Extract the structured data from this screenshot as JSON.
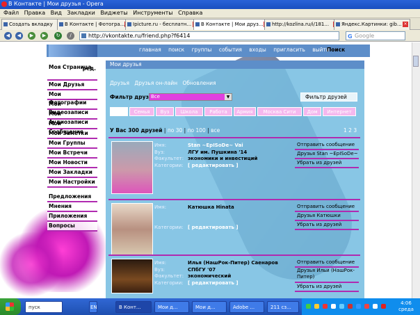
{
  "window": {
    "title": "В Контакте | Мои друзья - Opera"
  },
  "menubar": [
    "Файл",
    "Правка",
    "Вид",
    "Закладки",
    "Виджеты",
    "Инструменты",
    "Справка"
  ],
  "tabs": [
    {
      "label": "Создать вкладку"
    },
    {
      "label": "В Контакте | Фотогра..."
    },
    {
      "label": "Ipicture.ru - бесплатн..."
    },
    {
      "label": "В Контакте | Мои друз..."
    },
    {
      "label": "http://kozlina.ru/i/181..."
    },
    {
      "label": "Яндекс.Картинки: gib..."
    }
  ],
  "address": {
    "url": "http://vkontakte.ru/friend.php?f6414",
    "search_placeholder": "Google"
  },
  "vk": {
    "topnav": [
      "главная",
      "поиск",
      "группы",
      "события",
      "входы",
      "пригласить",
      "выйти"
    ],
    "search": "Поиск",
    "left_menu": [
      {
        "label": "Моя Страница",
        "extra": "ред."
      },
      {
        "label": "Мои Друзья"
      },
      {
        "label": "Мои Фотографии"
      },
      {
        "label": "Мои Видеозаписи"
      },
      {
        "label": "Мои Аудиозаписи"
      },
      {
        "label": "Мои Сообщения"
      },
      {
        "label": "Мои Заметки"
      },
      {
        "label": "Мои Группы"
      },
      {
        "label": "Мои Встречи"
      },
      {
        "label": "Мои Новости"
      },
      {
        "label": "Мои Закладки"
      },
      {
        "label": "Мои Настройки"
      }
    ],
    "left_menu_2": [
      "Предложения",
      "Мнения",
      "Приложения",
      "Вопросы"
    ],
    "main_title": "Мои друзья",
    "subtabs": [
      "Друзья",
      "Друзья он-лайн",
      "Обновления"
    ],
    "filter": {
      "label": "Фильтр друзей",
      "value": "Все",
      "button": "Фильтр друзей"
    },
    "categories": [
      "",
      "Семья",
      "Вуз",
      "Школа",
      "Работа",
      "Армия",
      "Москва Сити",
      "Дом",
      "Интернет"
    ],
    "count": {
      "text": "У Вас 300 друзей",
      "sep": "|",
      "by30": "по 30",
      "by100": "по 100",
      "all": "все"
    },
    "pages": [
      "1",
      "2",
      "3"
    ],
    "field_labels": {
      "name": "Имя:",
      "uni": "Вуз:",
      "faculty": "Факультет:",
      "category": "Категории:"
    },
    "friends": [
      {
        "name": "Stan ~EpISoDe~ Vai",
        "uni": "ЛГУ им. Пушкина '14",
        "faculty": "экономики и инвестиций",
        "category": "[ редактировать ]",
        "actions": [
          "Отправить сообщение",
          "Друзья Stan ~EpISoDe~",
          "Убрать из друзей"
        ]
      },
      {
        "name": "Катюшка Hinata",
        "uni": "",
        "faculty": "",
        "category": "[ редактировать ]",
        "actions": [
          "Отправить сообщение",
          "Друзья Катюшки",
          "Убрать из друзей"
        ]
      },
      {
        "name": "Илья (НашРок-Питер) Саенаров",
        "uni": "СПбГУ '07",
        "faculty": "экономический",
        "category": "[ редактировать ]",
        "actions": [
          "Отправить сообщение",
          "Друзья Ильи (НашРок-Питер)",
          "Убрать из друзей"
        ]
      }
    ]
  },
  "taskbar": {
    "items": [
      {
        "label": "пуск"
      },
      {
        "label": "В Конт..."
      },
      {
        "label": "Мои д..."
      },
      {
        "label": "Мои д..."
      },
      {
        "label": "Adobe ..."
      },
      {
        "label": "211 сз..."
      }
    ],
    "lang": "EN",
    "clock_time": "4:06",
    "clock_day": "среда"
  }
}
